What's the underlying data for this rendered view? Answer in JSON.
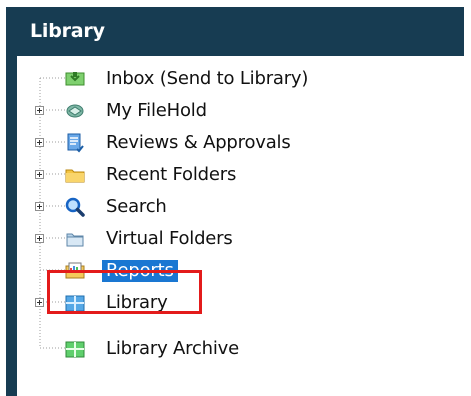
{
  "library_panel": {
    "title": "Library",
    "background_color": "#173c52",
    "selection_color": "#1a77d2",
    "highlight_color": "#e31b1b"
  },
  "tree": {
    "items": [
      {
        "label": "Inbox (Send to Library)",
        "icon": "inbox-icon",
        "expandable": false,
        "selected": false
      },
      {
        "label": "My FileHold",
        "icon": "my-filehold-icon",
        "expandable": true,
        "selected": false
      },
      {
        "label": "Reviews & Approvals",
        "icon": "reviews-icon",
        "expandable": true,
        "selected": false
      },
      {
        "label": "Recent Folders",
        "icon": "folder-icon",
        "expandable": true,
        "selected": false
      },
      {
        "label": "Search",
        "icon": "search-icon",
        "expandable": true,
        "selected": false
      },
      {
        "label": "Virtual Folders",
        "icon": "virtual-folder-icon",
        "expandable": true,
        "selected": false
      },
      {
        "label": "Reports",
        "icon": "reports-icon",
        "expandable": false,
        "selected": true
      },
      {
        "label": "Library",
        "icon": "library-icon",
        "expandable": true,
        "selected": false
      },
      {
        "label": "Library Archive",
        "icon": "library-archive-icon",
        "expandable": false,
        "selected": false
      }
    ]
  }
}
